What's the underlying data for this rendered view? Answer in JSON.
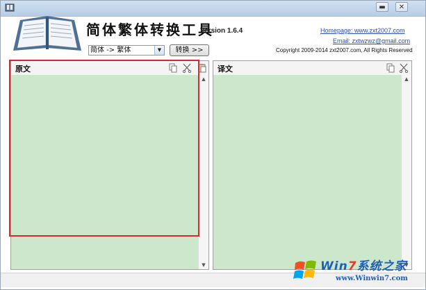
{
  "window": {
    "minimize_label": "▬",
    "close_label": "✕"
  },
  "header": {
    "app_title": "简体繁体转换工具",
    "version": "Version 1.6.4",
    "direction_select": "简体 -> 繁体",
    "convert_button": "转换 >>",
    "homepage": "Homepage: www.zxt2007.com",
    "email": "Email: zxtwzwz@gmail.com",
    "copyright": "Copyright 2009-2014 zxt2007.com, All Rights Reserved"
  },
  "source_panel": {
    "title": "原文",
    "icons": [
      "copy-icon",
      "cut-icon",
      "paste-icon"
    ]
  },
  "target_panel": {
    "title": "译文",
    "icons": [
      "copy-icon",
      "cut-icon"
    ]
  },
  "watermark": {
    "brand_pre": "Win",
    "brand_num": "7",
    "brand_post": "系统之家",
    "url": "www.Winwin7.com"
  },
  "colors": {
    "text_area": "#cde7cc",
    "highlight": "#d42a2a",
    "link": "#2a4fb0"
  }
}
